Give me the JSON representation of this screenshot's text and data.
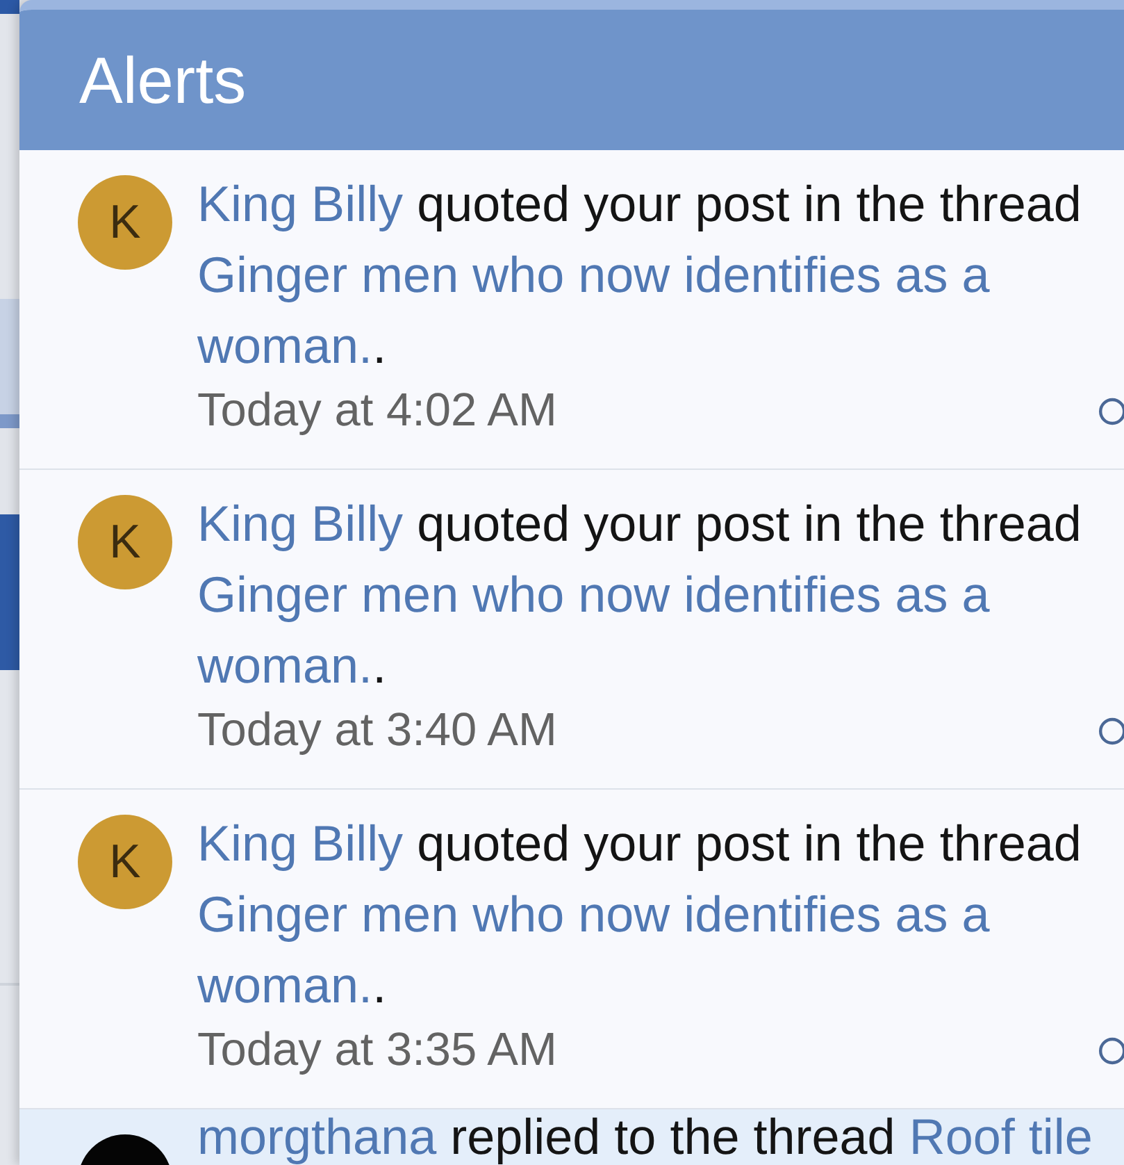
{
  "panel": {
    "title": "Alerts"
  },
  "alerts": [
    {
      "unread": false,
      "avatar": {
        "kind": "letter",
        "letter": "K",
        "color": "#cc9a33"
      },
      "user": "King Billy",
      "action": "quoted your post in the thread",
      "thread": "Ginger men who now identifies as a woman.",
      "suffix": ".",
      "time": "Today at 4:02 AM"
    },
    {
      "unread": false,
      "avatar": {
        "kind": "letter",
        "letter": "K",
        "color": "#cc9a33"
      },
      "user": "King Billy",
      "action": "quoted your post in the thread",
      "thread": "Ginger men who now identifies as a woman.",
      "suffix": ".",
      "time": "Today at 3:40 AM"
    },
    {
      "unread": false,
      "avatar": {
        "kind": "letter",
        "letter": "K",
        "color": "#cc9a33"
      },
      "user": "King Billy",
      "action": "quoted your post in the thread",
      "thread": "Ginger men who now identifies as a woman.",
      "suffix": ".",
      "time": "Today at 3:35 AM"
    },
    {
      "unread": true,
      "avatar": {
        "kind": "photo"
      },
      "user": "morgthana",
      "action": "replied to the thread",
      "thread": "Roof tile"
    }
  ]
}
